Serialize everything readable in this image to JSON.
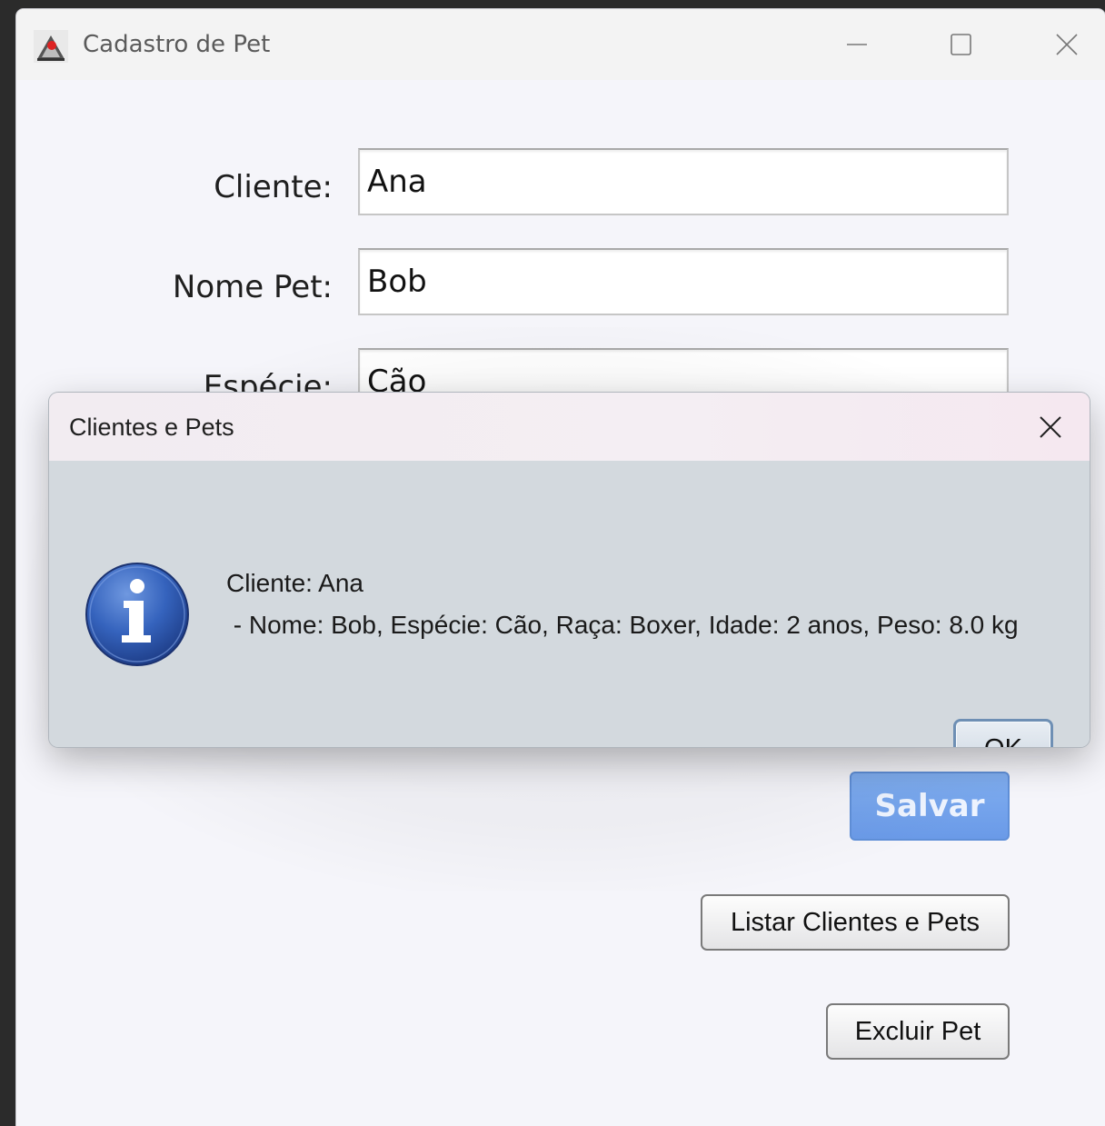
{
  "window": {
    "title": "Cadastro de Pet",
    "icon": "java-duke-icon"
  },
  "form": {
    "cliente_label": "Cliente:",
    "cliente_value": "Ana",
    "nome_pet_label": "Nome Pet:",
    "nome_pet_value": "Bob",
    "especie_label": "Espécie:",
    "especie_value": "Cão"
  },
  "buttons": {
    "salvar": "Salvar",
    "listar": "Listar Clientes e Pets",
    "excluir": "Excluir Pet"
  },
  "dialog": {
    "title": "Clientes e Pets",
    "icon": "info-icon",
    "message_line_1": "Cliente: Ana",
    "message_line_2": " - Nome: Bob, Espécie: Cão, Raça: Boxer, Idade: 2 anos, Peso: 8.0 kg",
    "ok_label": "OK"
  },
  "colors": {
    "salvar_button": "#6f9fea",
    "dialog_body": "#d3d9de",
    "info_icon_blue": "#2f5cb8"
  }
}
